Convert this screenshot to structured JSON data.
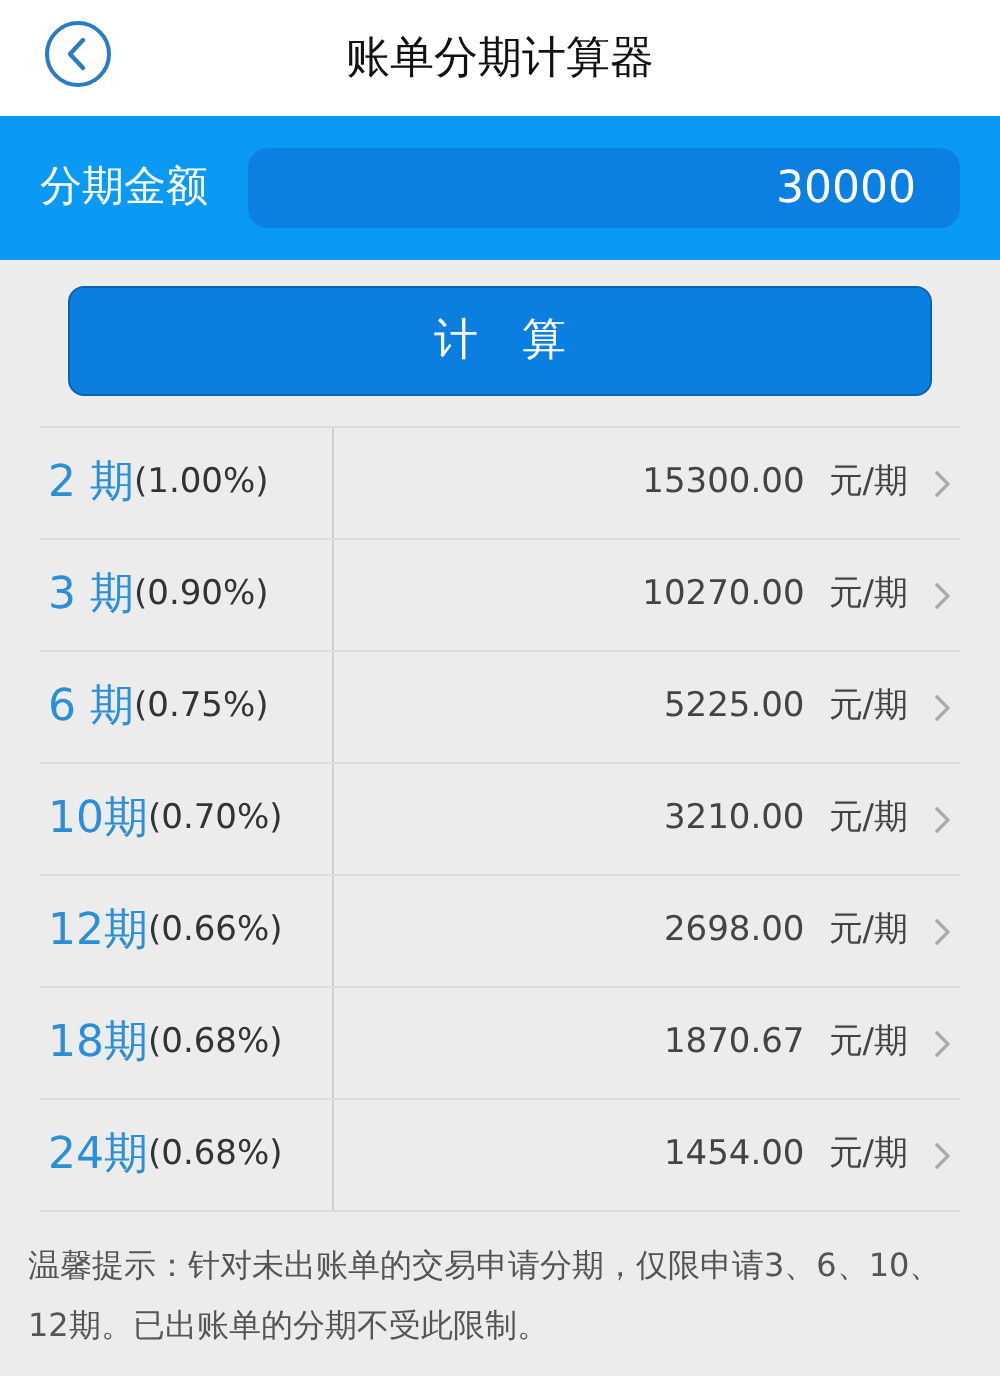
{
  "header": {
    "title": "账单分期计算器"
  },
  "amount_field": {
    "label": "分期金额",
    "value": "30000"
  },
  "calculate_button": {
    "label": "计　算"
  },
  "rows": [
    {
      "term": "2 期",
      "rate": "(1.00%)",
      "amount": "15300.00",
      "unit": "元/期"
    },
    {
      "term": "3 期",
      "rate": "(0.90%)",
      "amount": "10270.00",
      "unit": "元/期"
    },
    {
      "term": "6 期",
      "rate": "(0.75%)",
      "amount": "5225.00",
      "unit": "元/期"
    },
    {
      "term": "10期",
      "rate": "(0.70%)",
      "amount": "3210.00",
      "unit": "元/期"
    },
    {
      "term": "12期",
      "rate": "(0.66%)",
      "amount": "2698.00",
      "unit": "元/期"
    },
    {
      "term": "18期",
      "rate": "(0.68%)",
      "amount": "1870.67",
      "unit": "元/期"
    },
    {
      "term": "24期",
      "rate": "(0.68%)",
      "amount": "1454.00",
      "unit": "元/期"
    }
  ],
  "note": "温馨提示：针对未出账单的交易申请分期，仅限申请3、6、10、12期。已出账单的分期不受此限制。"
}
